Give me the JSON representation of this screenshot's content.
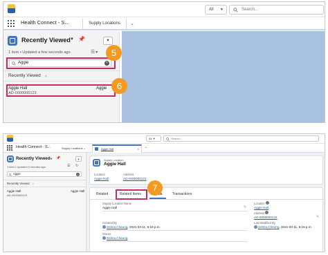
{
  "shot1": {
    "search_scope": "All",
    "global_search_placeholder": "Search...",
    "app_name": "Health Connect - S...",
    "tab": "Supply Locations",
    "list_view": {
      "title": "Recently Viewed",
      "subtitle": "1 item • Updated a few seconds ago",
      "search_value": "Aggie",
      "column_header": "Recently Viewed",
      "sort_arrow": "↓",
      "row": {
        "name": "Aggie Hall",
        "id": "AD-0000000123",
        "right_label": "Aggie"
      }
    },
    "badges": [
      "5",
      "6"
    ]
  },
  "shot2": {
    "search_scope": "All",
    "global_search_placeholder": "Search...",
    "app_name": "Health Connect - S...",
    "tabs": [
      "Supply Locations",
      "Aggie Hall"
    ],
    "list_view": {
      "title": "Recently Viewed",
      "subtitle": "1 item • Updated 5 minutes ago",
      "search_value": "Aggie",
      "column_header": "Recently Viewed",
      "sort_arrow": "↓",
      "row": {
        "name": "Aggie Hall",
        "id": "AD-0000000123",
        "right_label": "Aggie Hall"
      }
    },
    "record": {
      "object_label": "Supply Location",
      "name": "Aggie Hall",
      "highlights": [
        {
          "label": "Location",
          "value": "Aggie Hall"
        },
        {
          "label": "Address",
          "value": "AD-0000000123"
        }
      ],
      "tabs": [
        "Related",
        "Related Items",
        "Details",
        "Transactions"
      ],
      "fields_left": [
        {
          "label": "Supply Location Name",
          "value": "Aggie Hall"
        },
        {
          "label": "Created By",
          "value": "Selma Cheung",
          "extra": "2021-03-11, 6:19 p.m."
        },
        {
          "label": "Owner",
          "value": "Selma Cheung"
        }
      ],
      "fields_right": [
        {
          "label": "Location",
          "value": "Aggie Hall"
        },
        {
          "label": "Address",
          "value": "AD-0000000123"
        },
        {
          "label": "Last Modified By",
          "value": "Selma Cheung",
          "extra": "2021-03-11, 6:19 p.m."
        }
      ]
    },
    "badge": "7"
  },
  "colors": {
    "highlight_box": "#c22e63",
    "badge": "#f39a20",
    "brand_blue": "#3e73c2",
    "backdrop": "#a9c1e0"
  }
}
